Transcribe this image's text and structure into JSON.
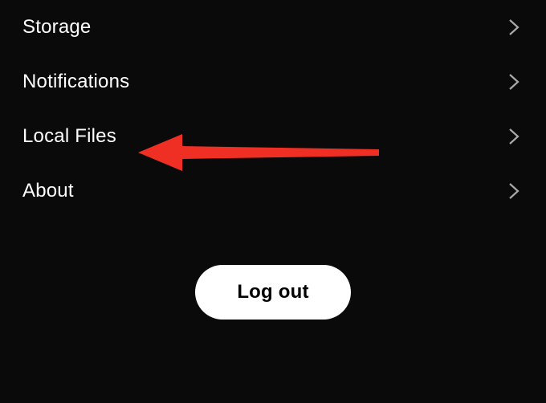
{
  "settings": {
    "items": [
      {
        "label": "Storage"
      },
      {
        "label": "Notifications"
      },
      {
        "label": "Local Files"
      },
      {
        "label": "About"
      }
    ]
  },
  "logout": {
    "label": "Log out"
  },
  "annotation": {
    "arrow_color": "#ef2f24"
  }
}
